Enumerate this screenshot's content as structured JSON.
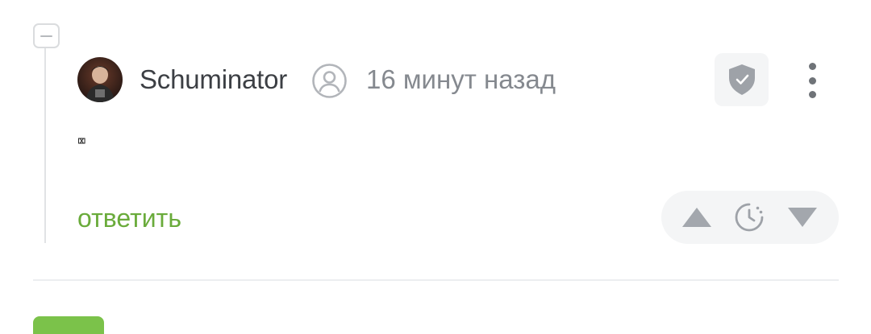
{
  "comment": {
    "username": "Schuminator",
    "timestamp": "16 минут назад",
    "body_text": "⌧",
    "reply_label": "ответить"
  },
  "icons": {
    "collapse": "minus-icon",
    "user": "user-circle-icon",
    "moderation": "shield-check-icon",
    "more": "more-vertical-icon",
    "vote_up": "triangle-up-icon",
    "rating_pending": "clock-icon",
    "vote_down": "triangle-down-icon"
  },
  "colors": {
    "accent_green": "#6aab3b",
    "button_green": "#7bc24a",
    "text_primary": "#3c3f44",
    "text_muted": "#85898f",
    "icon_gray": "#a0a4aa"
  }
}
